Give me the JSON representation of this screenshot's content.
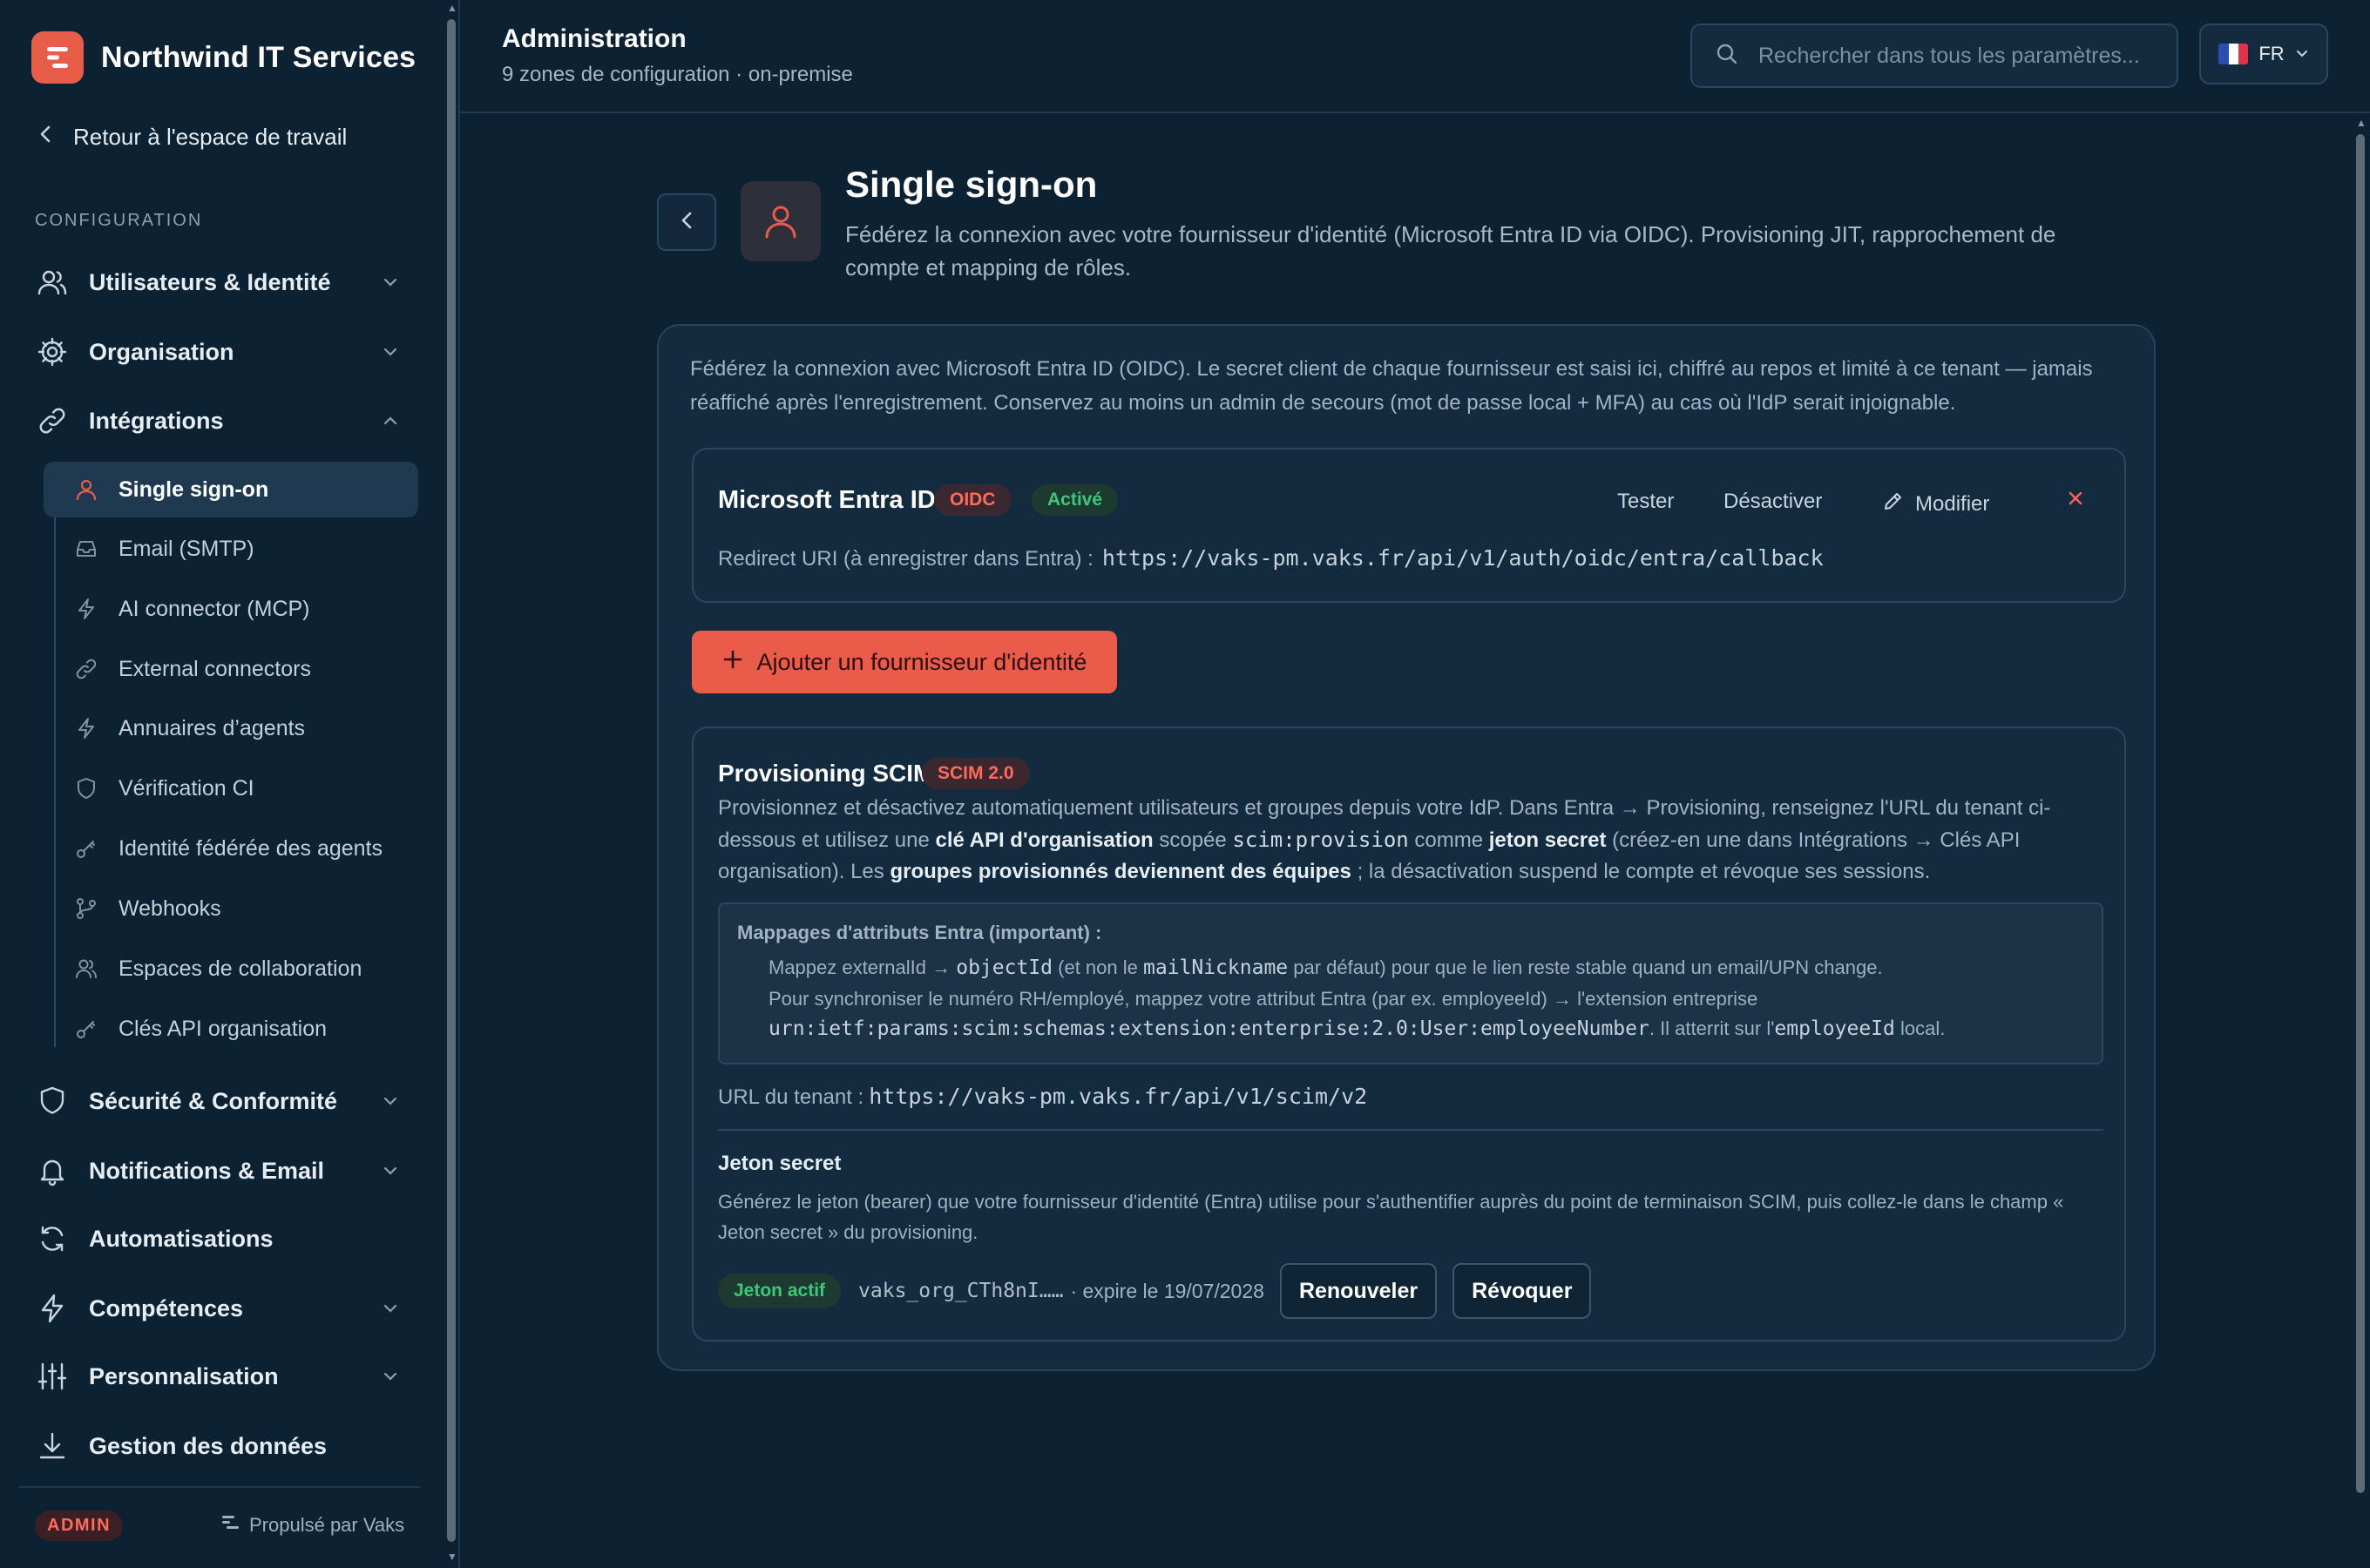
{
  "brand": {
    "name": "Northwind IT Services"
  },
  "sidebar": {
    "back_label": "Retour à l'espace de travail",
    "section": "CONFIGURATION",
    "items": [
      {
        "label": "Utilisateurs & Identité",
        "icon": "users-icon"
      },
      {
        "label": "Organisation",
        "icon": "gear-icon"
      },
      {
        "label": "Intégrations",
        "icon": "link-icon"
      },
      {
        "label": "Sécurité & Conformité",
        "icon": "shield-icon"
      },
      {
        "label": "Notifications & Email",
        "icon": "bell-icon"
      },
      {
        "label": "Automatisations",
        "icon": "refresh-icon"
      },
      {
        "label": "Compétences",
        "icon": "bolt-icon"
      },
      {
        "label": "Personnalisation",
        "icon": "sliders-icon"
      },
      {
        "label": "Gestion des données",
        "icon": "download-icon"
      }
    ],
    "sub_items": [
      {
        "label": "Single sign-on",
        "icon": "user-icon",
        "active": true
      },
      {
        "label": "Email (SMTP)",
        "icon": "inbox-icon"
      },
      {
        "label": "AI connector (MCP)",
        "icon": "bolt-icon"
      },
      {
        "label": "External connectors",
        "icon": "link-icon"
      },
      {
        "label": "Annuaires d’agents",
        "icon": "bolt-icon"
      },
      {
        "label": "Vérification CI",
        "icon": "shield-icon"
      },
      {
        "label": "Identité fédérée des agents",
        "icon": "key-icon"
      },
      {
        "label": "Webhooks",
        "icon": "branch-icon"
      },
      {
        "label": "Espaces de collaboration",
        "icon": "users-icon"
      },
      {
        "label": "Clés API organisation",
        "icon": "key-icon"
      }
    ],
    "footer": {
      "badge": "ADMIN",
      "powered": "Propulsé par Vaks"
    }
  },
  "header": {
    "title": "Administration",
    "subtitle": "9 zones de configuration · on-premise",
    "search_placeholder": "Rechercher dans tous les paramètres...",
    "lang": "FR"
  },
  "page": {
    "title": "Single sign-on",
    "description": "Fédérez la connexion avec votre fournisseur d'identité (Microsoft Entra ID via OIDC). Provisioning JIT, rapprochement de compte et mapping de rôles."
  },
  "card": {
    "intro": "Fédérez la connexion avec Microsoft Entra ID (OIDC). Le secret client de chaque fournisseur est saisi ici, chiffré au repos et limité à ce tenant — jamais réaffiché après l'enregistrement. Conservez au moins un admin de secours (mot de passe local + MFA) au cas où l'IdP serait injoignable.",
    "provider": {
      "name": "Microsoft Entra ID",
      "protocol": "OIDC",
      "status": "Activé",
      "actions": {
        "test": "Tester",
        "disable": "Désactiver",
        "edit": "Modifier"
      },
      "redirect_label": "Redirect URI (à enregistrer dans Entra) :",
      "redirect_uri": "https://vaks-pm.vaks.fr/api/v1/auth/oidc/entra/callback"
    },
    "add_provider": "Ajouter un fournisseur d'identité",
    "scim": {
      "title": "Provisioning SCIM",
      "badge": "SCIM 2.0",
      "desc": {
        "p1": "Provisionnez et désactivez automatiquement utilisateurs et groupes depuis votre IdP. Dans Entra → Provisioning, renseignez l'URL du tenant ci-dessous et utilisez une ",
        "b1": "clé API d'organisation",
        "p2": " scopée ",
        "code1": "scim:provision",
        "p3": " comme ",
        "b2": "jeton secret",
        "p4": " (créez-en une dans Intégrations → Clés API organisation). Les ",
        "b3": "groupes provisionnés deviennent des équipes",
        "p5": " ; la désactivation suspend le compte et révoque ses sessions."
      },
      "mapping": {
        "title": "Mappages d'attributs Entra (important) :",
        "l1a": "Mappez externalId → ",
        "l1code1": "objectId",
        "l1b": " (et non le ",
        "l1code2": "mailNickname",
        "l1c": " par défaut) pour que le lien reste stable quand un email/UPN change.",
        "l2": "Pour synchroniser le numéro RH/employé, mappez votre attribut Entra (par ex. employeeId) → l'extension entreprise",
        "l3code": "urn:ietf:params:scim:schemas:extension:enterprise:2.0:User:employeeNumber",
        "l3a": ". Il atterrit sur l'",
        "l3code2": "employeeId",
        "l3b": " local."
      },
      "tenant_label": "URL du tenant :",
      "tenant_url": "https://vaks-pm.vaks.fr/api/v1/scim/v2",
      "token": {
        "title": "Jeton secret",
        "desc": "Générez le jeton (bearer) que votre fournisseur d'identité (Entra) utilise pour s'authentifier auprès du point de terminaison SCIM, puis collez-le dans le champ « Jeton secret » du provisioning.",
        "status": "Jeton actif",
        "value": "vaks_org_CTh8nI……",
        "expires": "· expire le 19/07/2028",
        "renew": "Renouveler",
        "revoke": "Révoquer"
      }
    }
  },
  "colors": {
    "accent": "#ea5b4a",
    "success": "#3ec779",
    "background": "#0c2233",
    "card": "#122b3e"
  }
}
